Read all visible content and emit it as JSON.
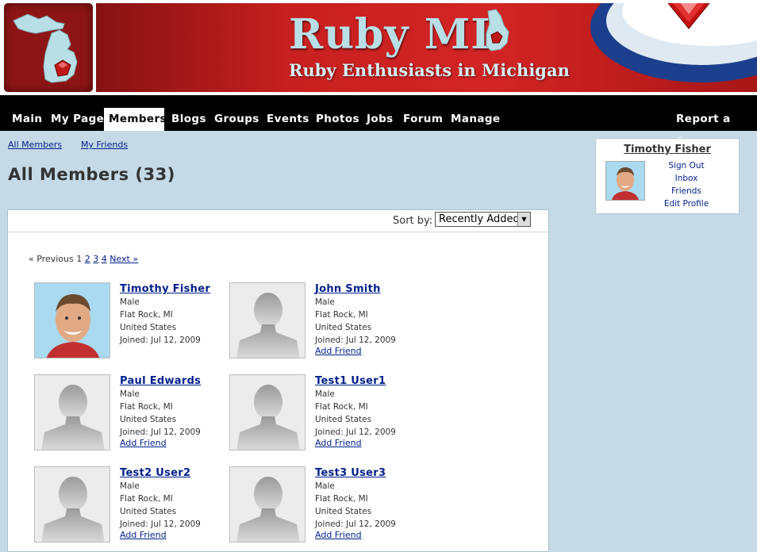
{
  "banner": {
    "title": "Ruby MI",
    "subtitle": "Ruby Enthusiasts in Michigan"
  },
  "nav": {
    "items": [
      "Main",
      "My Page",
      "Members",
      "Blogs",
      "Groups",
      "Events",
      "Photos",
      "Jobs",
      "Forum",
      "Manage"
    ],
    "active": "Members",
    "report_bug": "Report a Bug"
  },
  "subnav": {
    "all_members": "All Members",
    "my_friends": "My Friends"
  },
  "page_title": "All Members (33)",
  "sort": {
    "label": "Sort by:",
    "selected": "Recently Added"
  },
  "pager": {
    "previous": "« Previous",
    "current": "1",
    "pages": [
      "2",
      "3",
      "4"
    ],
    "next": "Next »"
  },
  "members": [
    {
      "name": "Timothy Fisher",
      "gender": "Male",
      "location": "Flat Rock, MI",
      "country": "United States",
      "joined": "Joined: Jul 12, 2009",
      "add_friend": ""
    },
    {
      "name": "John Smith",
      "gender": "Male",
      "location": "Flat Rock, MI",
      "country": "United States",
      "joined": "Joined: Jul 12, 2009",
      "add_friend": "Add Friend"
    },
    {
      "name": "Paul Edwards",
      "gender": "Male",
      "location": "Flat Rock, MI",
      "country": "United States",
      "joined": "Joined: Jul 12, 2009",
      "add_friend": "Add Friend"
    },
    {
      "name": "Test1 User1",
      "gender": "Male",
      "location": "Flat Rock, MI",
      "country": "United States",
      "joined": "Joined: Jul 12, 2009",
      "add_friend": "Add Friend"
    },
    {
      "name": "Test2 User2",
      "gender": "Male",
      "location": "Flat Rock, MI",
      "country": "United States",
      "joined": "Joined: Jul 12, 2009",
      "add_friend": "Add Friend"
    },
    {
      "name": "Test3 User3",
      "gender": "Male",
      "location": "Flat Rock, MI",
      "country": "United States",
      "joined": "Joined: Jul 12, 2009",
      "add_friend": "Add Friend"
    }
  ],
  "userbox": {
    "name": "Timothy Fisher",
    "links": [
      "Sign Out",
      "Inbox",
      "Friends",
      "Edit Profile"
    ]
  },
  "colors": {
    "banner_red": "#c82020",
    "link_blue": "#001f8a",
    "page_bg": "#c5d9e6",
    "nav_bg": "#000000"
  }
}
